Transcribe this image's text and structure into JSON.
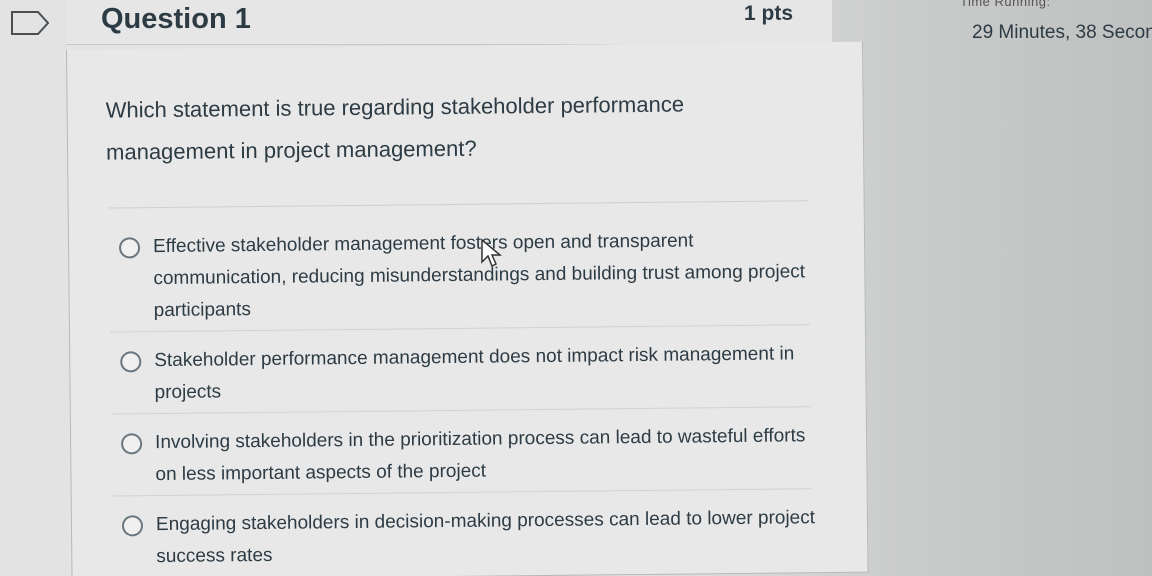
{
  "question": {
    "title": "Question 1",
    "points": "1 pts",
    "text": "Which statement is true regarding stakeholder performance management in project management?"
  },
  "answers": [
    {
      "label": "Effective stakeholder management fosters open and transparent communication, reducing misunderstandings and building trust among project participants"
    },
    {
      "label": "Stakeholder performance management does not impact risk management in projects"
    },
    {
      "label": "Involving stakeholders in the prioritization process can lead to wasteful efforts on less important aspects of the project"
    },
    {
      "label": "Engaging stakeholders in decision-making processes can lead to lower project success rates"
    }
  ],
  "timer": {
    "label": "Time Running:",
    "value": "29 Minutes, 38 Secon"
  },
  "icons": {
    "flag": "flag-icon",
    "cursor": "mouse-pointer-icon"
  }
}
